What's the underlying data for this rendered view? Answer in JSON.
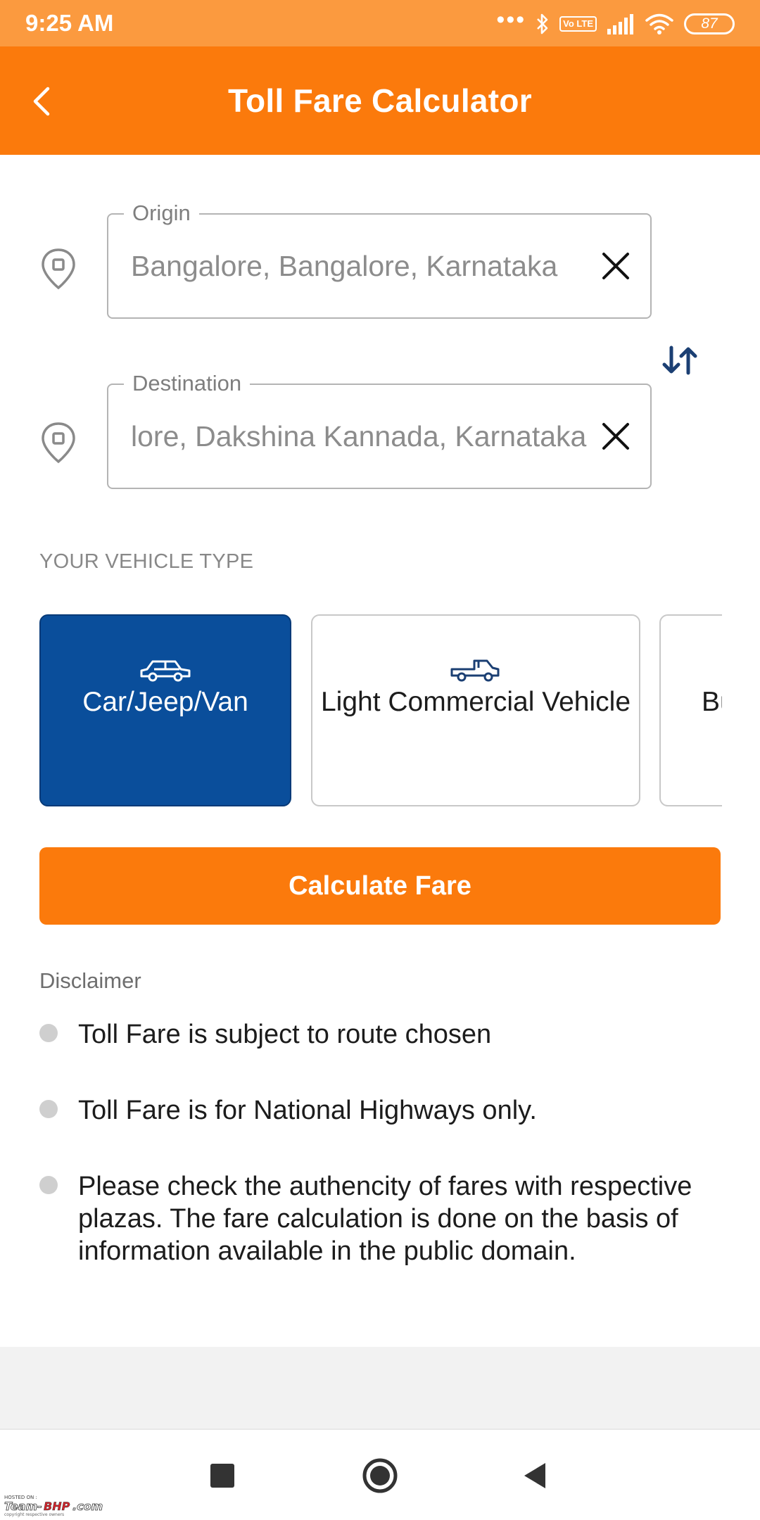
{
  "status_bar": {
    "time": "9:25 AM",
    "dots": "•••",
    "volte": "Vo LTE",
    "battery": "87"
  },
  "app_bar": {
    "title": "Toll Fare Calculator"
  },
  "origin": {
    "label": "Origin",
    "value": "Bangalore, Bangalore, Karnataka"
  },
  "destination": {
    "label": "Destination",
    "value": "lore, Dakshina Kannada, Karnataka"
  },
  "vehicle_section": {
    "label": "YOUR VEHICLE TYPE",
    "options": [
      {
        "label": "Car/Jeep/Van",
        "icon": "car-icon",
        "selected": true
      },
      {
        "label": "Light Commercial Vehicle",
        "icon": "pickup-truck-icon",
        "selected": false
      },
      {
        "label": "Bu",
        "icon": "bus-icon",
        "selected": false
      }
    ]
  },
  "calculate_button": {
    "label": "Calculate Fare"
  },
  "disclaimer": {
    "title": "Disclaimer",
    "items": [
      "Toll Fare is subject to route chosen",
      "Toll Fare is for National Highways only.",
      "Please check the authencity of fares with respective plazas. The fare calculation is done on the basis of information available in the public domain."
    ]
  },
  "watermark": {
    "line1": "HOSTED ON :",
    "brand": "Team-BHP.com",
    "line3": "copyright respective owners"
  },
  "colors": {
    "primary": "#fb7a0c",
    "status_bar": "#fb9a3f",
    "selected_card": "#0a4e9b",
    "swap_icon": "#1b3f73"
  }
}
